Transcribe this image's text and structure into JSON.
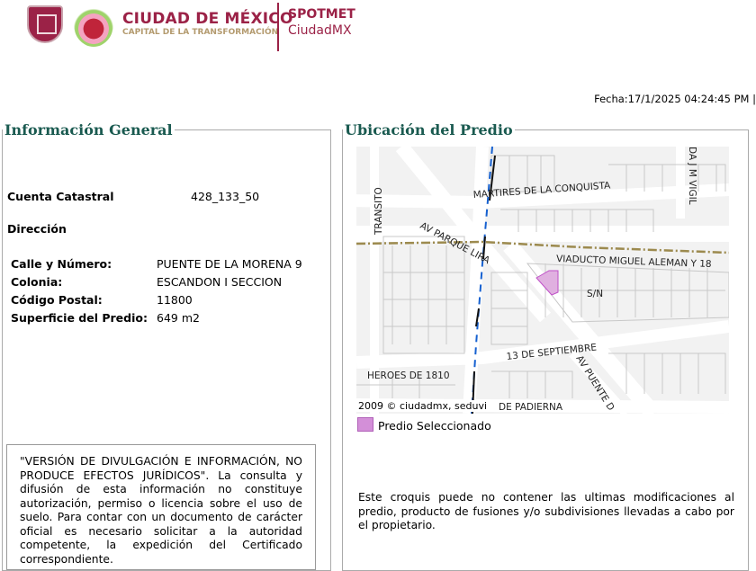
{
  "header": {
    "brand_title": "CIUDAD DE MÉXICO",
    "brand_subtitle": "CAPITAL DE LA TRANSFORMACIÓN",
    "app_name": "SPOTMET",
    "app_sub": "CiudadMX"
  },
  "fecha": "Fecha:17/1/2025 04:24:45 PM |",
  "general": {
    "title": "Información General",
    "cuenta_label": "Cuenta Catastral",
    "cuenta_value": "428_133_50",
    "direccion_label": "Dirección",
    "fields": [
      {
        "label": "Calle y Número:",
        "value": "PUENTE DE LA MORENA 9"
      },
      {
        "label": "Colonia:",
        "value": "ESCANDON I SECCION"
      },
      {
        "label": "Código Postal:",
        "value": "11800"
      },
      {
        "label": "Superficie del Predio:",
        "value": "649 m2"
      }
    ]
  },
  "disclaimer": "\"VERSIÓN DE DIVULGACIÓN E INFORMACIÓN, NO PRODUCE EFECTOS JURÍDICOS\". La consulta y difusión de esta información no constituye autorización, permiso o licencia sobre el uso de suelo. Para contar con un documento de carácter oficial es necesario solicitar a la autoridad competente, la expedición del Certificado correspondiente.",
  "ubicacion": {
    "title": "Ubicación del Predio",
    "streets": [
      "MARTIRES DE LA CONQUISTA",
      "TRANSITO",
      "AV PARQUE LIRA",
      "VIADUCTO MIGUEL ALEMAN Y 18",
      "S/N",
      "13 DE SEPTIEMBRE",
      "AV PUENTE D",
      "HEROES DE 1810",
      "DA J M VIGIL",
      "DE PADIERNA"
    ],
    "copyright": "2009 © ciudadmx, seduvi",
    "legend_label": "Predio Seleccionado",
    "legend_color": "#d38fd8",
    "note": "Este croquis puede no contener las ultimas modificaciones al predio, producto de fusiones y/o subdivisiones llevadas a cabo por el propietario."
  }
}
